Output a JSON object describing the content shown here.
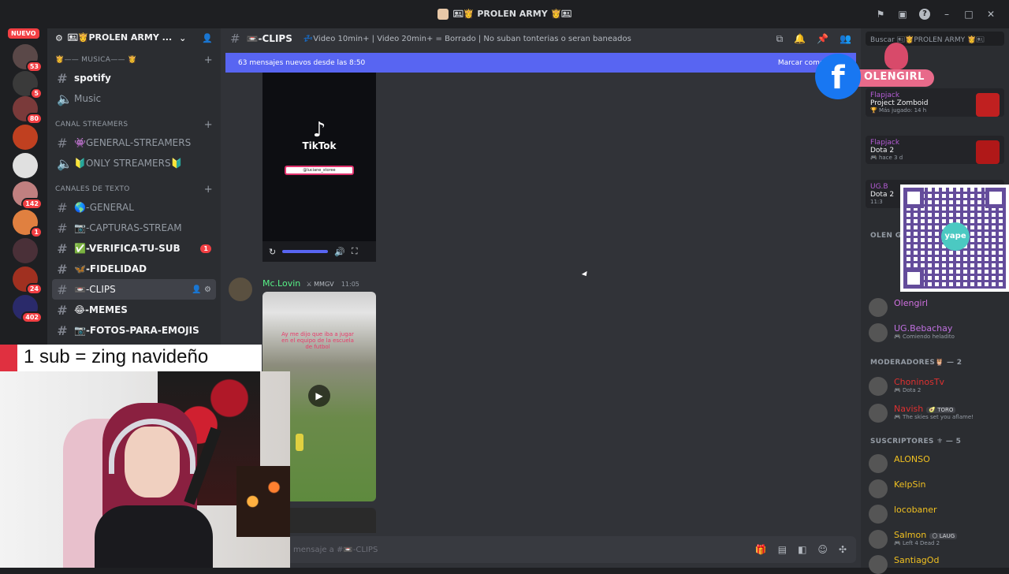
{
  "window": {
    "title": "🖭👸 PROLEN ARMY 👸🖭"
  },
  "guilds": {
    "nuevo_label": "NUEVO",
    "items": [
      {
        "badge": "53",
        "color": "#5a4848"
      },
      {
        "badge": "5",
        "color": "#3a3a3a"
      },
      {
        "badge": "80",
        "color": "#7a3a3a"
      },
      {
        "badge": "",
        "color": "#c04020"
      },
      {
        "badge": "",
        "color": "#e0e0e0"
      },
      {
        "badge": "142",
        "color": "#c08080"
      },
      {
        "badge": "1",
        "color": "#e08040"
      },
      {
        "badge": "",
        "color": "#4a3038"
      },
      {
        "badge": "24",
        "color": "#a03020"
      },
      {
        "badge": "402",
        "color": "#2a2a6a"
      }
    ]
  },
  "server": {
    "name": "🖭👸PROLEN ARMY ...",
    "categories": [
      {
        "label": "👸—— MUSICA—— 👸",
        "channels": [
          {
            "icon": "#",
            "name": "spotify",
            "state": "bright"
          },
          {
            "icon": "🔈",
            "name": "Music",
            "state": "normal"
          }
        ]
      },
      {
        "label": "CANAL STREAMERS",
        "channels": [
          {
            "icon": "#",
            "name": "👾GENERAL-STREAMERS",
            "state": "normal"
          },
          {
            "icon": "🔈",
            "name": "🔰ONLY STREAMERS🔰",
            "state": "normal"
          }
        ]
      },
      {
        "label": "CANALES DE TEXTO",
        "channels": [
          {
            "icon": "#",
            "name": "🌎-GENERAL",
            "state": "normal"
          },
          {
            "icon": "#",
            "name": "📷-CAPTURAS-STREAM",
            "state": "normal"
          },
          {
            "icon": "#",
            "name": "✅-VERIFICA-TU-SUB",
            "state": "bright",
            "notif": "1"
          },
          {
            "icon": "#",
            "name": "🦋-FIDELIDAD",
            "state": "bright"
          },
          {
            "icon": "#",
            "name": "📼-CLIPS",
            "state": "active"
          },
          {
            "icon": "#",
            "name": "😂-MEMES",
            "state": "bright"
          },
          {
            "icon": "#",
            "name": "📷-FOTOS-PARA-EMOJIS",
            "state": "bright"
          },
          {
            "icon": "#",
            "name": "🎶-MUSICA",
            "state": "normal"
          },
          {
            "icon": "#",
            "name": "🎉-PARTY-RANKED",
            "state": "normal"
          }
        ]
      }
    ]
  },
  "channel": {
    "name": "📼-CLIPS",
    "topic": "💤Video 10min+ | Video 20min+ = Borrado | No suban tonterias o seran baneados",
    "new_messages": "63 mensajes nuevos desde las 8:50",
    "mark_read": "Marcar como leído",
    "composer_placeholder": "mensaje a #📼-CLIPS"
  },
  "messages": {
    "tiktok_label": "TikTok",
    "tiktok_handle": "@luciane_storee",
    "author": "Mc.Lovin",
    "author_tag": "⚔ MMGV",
    "time": "11:05",
    "video_caption": "Ay me dijo que iba a jugar en el equipo de la escuela de futbol"
  },
  "members": {
    "search_placeholder": "Buscar 🖭👸PROLEN ARMY 👸🖭",
    "activities": [
      {
        "name": "Flapjack",
        "game": "Project Zomboid",
        "meta": "🏆 Más jugado: 14 h",
        "color": "#c02020"
      },
      {
        "name": "Flapjack",
        "game": "Dota 2",
        "meta": "🎮 hace 3 d",
        "color": "#b01818"
      },
      {
        "name": "UG.B",
        "game": "Dota 2",
        "meta": "11:3",
        "color": "#333333"
      }
    ],
    "group_olen": "OLEN G",
    "olen_members": [
      {
        "name": "Olengirl",
        "status": "",
        "color": "#d070e0"
      },
      {
        "name": "UG.Bebachay",
        "status": "🎮 Comiendo heladito",
        "color": "#c070e0"
      }
    ],
    "group_mods": "MODERADORES🦉 — 2",
    "mods": [
      {
        "name": "ChoninosTv",
        "status": "🎮 Dota 2",
        "color": "#e03030"
      },
      {
        "name": "Navish",
        "tag": "🥑 TORO",
        "status": "🎮 The skies set you aflame!",
        "color": "#e03030"
      }
    ],
    "group_subs": "SUSCRIPTORES ⚜ — 5",
    "subs": [
      {
        "name": "ALONSO",
        "status": "",
        "color": "#f0c020"
      },
      {
        "name": "KelpSin",
        "status": "",
        "color": "#f0c020"
      },
      {
        "name": "locobaner",
        "status": "",
        "color": "#f0c020"
      },
      {
        "name": "Salmon",
        "tag": "🌕 LAUG",
        "status": "🎮 Left 4 Dead 2",
        "color": "#f0c020"
      },
      {
        "name": "SantiagOd",
        "status": "",
        "color": "#f0c020"
      }
    ]
  },
  "overlays": {
    "facebook_name": "OLENGIRL",
    "qr_label": "yape",
    "sub_banner": "1 sub = zing navideño"
  }
}
